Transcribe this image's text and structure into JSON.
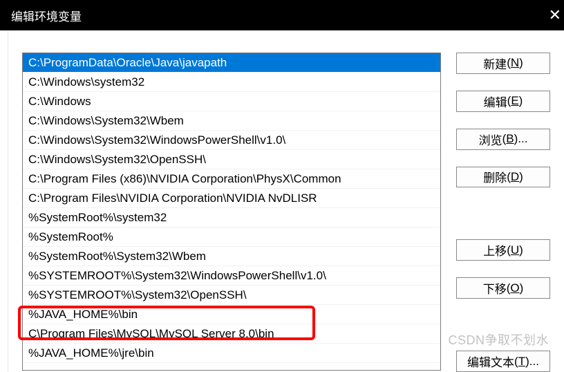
{
  "window": {
    "title": "编辑环境变量"
  },
  "paths": [
    "C:\\ProgramData\\Oracle\\Java\\javapath",
    "C:\\Windows\\system32",
    "C:\\Windows",
    "C:\\Windows\\System32\\Wbem",
    "C:\\Windows\\System32\\WindowsPowerShell\\v1.0\\",
    "C:\\Windows\\System32\\OpenSSH\\",
    "C:\\Program Files (x86)\\NVIDIA Corporation\\PhysX\\Common",
    "C:\\Program Files\\NVIDIA Corporation\\NVIDIA NvDLISR",
    "%SystemRoot%\\system32",
    "%SystemRoot%",
    "%SystemRoot%\\System32\\Wbem",
    "%SYSTEMROOT%\\System32\\WindowsPowerShell\\v1.0\\",
    "%SYSTEMROOT%\\System32\\OpenSSH\\",
    "%JAVA_HOME%\\bin",
    "C\\Program Files\\MySQL\\MySQL Server 8.0\\bin",
    "%JAVA_HOME%\\jre\\bin"
  ],
  "selected_index": 0,
  "buttons": {
    "new": {
      "text": "新建",
      "key": "N"
    },
    "edit": {
      "text": "编辑",
      "key": "E"
    },
    "browse": {
      "text": "浏览",
      "key": "B",
      "suffix": "..."
    },
    "delete": {
      "text": "删除",
      "key": "D"
    },
    "up": {
      "text": "上移",
      "key": "U"
    },
    "down": {
      "text": "下移",
      "key": "O"
    },
    "etext": {
      "text": "编辑文本",
      "key": "T",
      "suffix": "..."
    }
  },
  "watermark": "CSDN争取不划水"
}
